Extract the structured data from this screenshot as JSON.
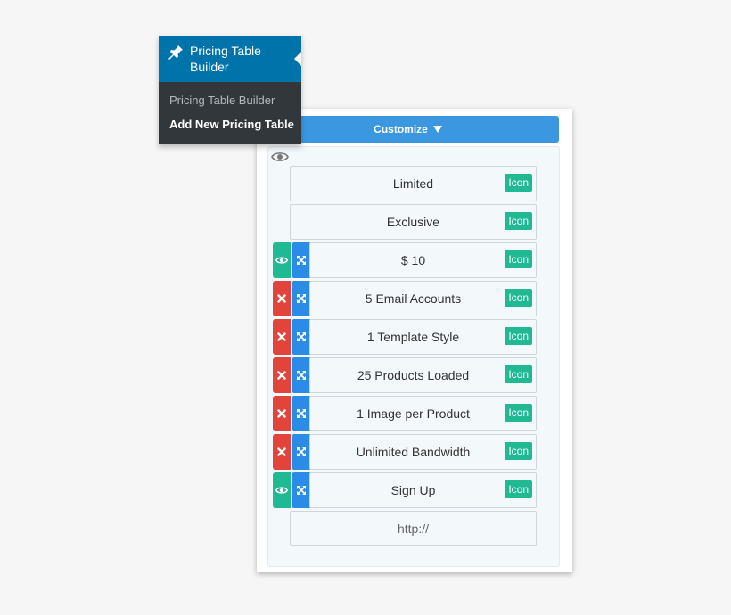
{
  "wp_menu": {
    "title": "Pricing Table Builder",
    "items": [
      {
        "label": "Pricing Table Builder",
        "current": false
      },
      {
        "label": "Add New Pricing Table",
        "current": true
      }
    ],
    "accent_color": "#0073aa",
    "submenu_bg": "#32373c"
  },
  "panel": {
    "customize_label": "Customize",
    "icon_label": "Icon",
    "rows": [
      {
        "text": "Limited"
      },
      {
        "text": "Exclusive"
      },
      {
        "text": "$ 10"
      },
      {
        "text": "5 Email Accounts"
      },
      {
        "text": "1 Template Style"
      },
      {
        "text": "25 Products Loaded"
      },
      {
        "text": "1 Image per Product"
      },
      {
        "text": "Unlimited Bandwidth"
      },
      {
        "text": "Sign Up"
      }
    ],
    "url_placeholder": "http://",
    "colors": {
      "customize": "#3a97e0",
      "delete": "#e0443b",
      "visibility": "#20b993",
      "move": "#2a8ce6",
      "icon_badge": "#20b993"
    },
    "icons": {
      "visibility": "eye-icon",
      "delete": "close-icon",
      "move": "move-icon",
      "pin": "pin-icon",
      "caret": "caret-down-icon"
    }
  }
}
